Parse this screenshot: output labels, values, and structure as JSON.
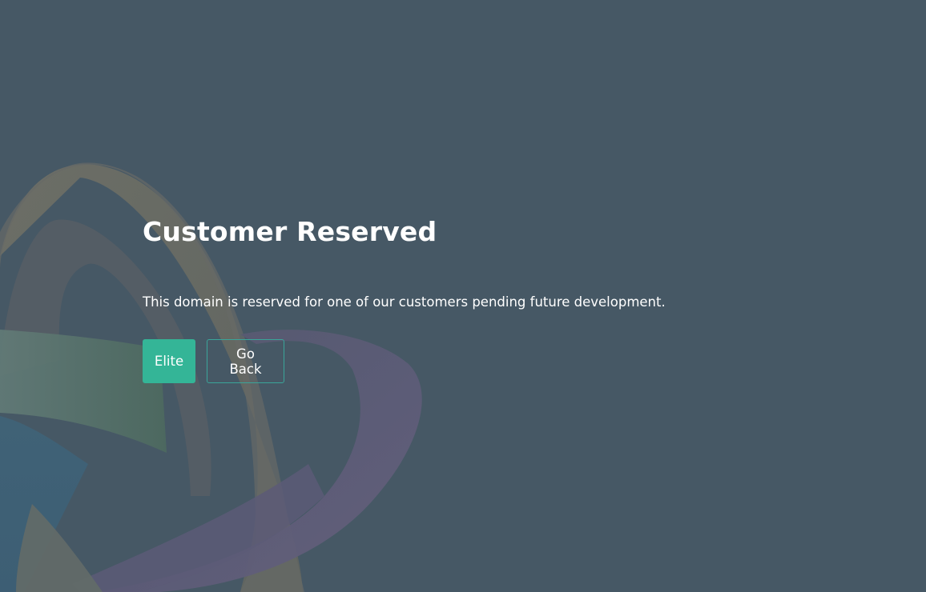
{
  "page": {
    "title": "Customer Reserved",
    "message": "This domain is reserved for one of our customers pending future development."
  },
  "actions": {
    "primary_label": "Elite",
    "secondary_label": "Go Back"
  },
  "colors": {
    "background": "#465865",
    "primary_button": "#34b597",
    "outline_button_border": "#3aa59a",
    "text": "#ffffff"
  }
}
